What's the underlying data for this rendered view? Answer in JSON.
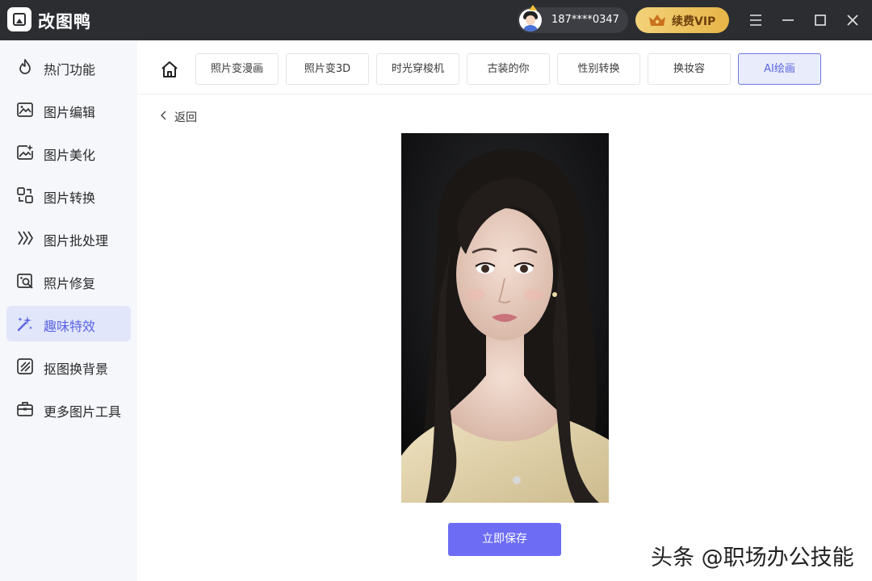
{
  "app": {
    "title": "改图鸭"
  },
  "user": {
    "phone": "187****0347"
  },
  "vip": {
    "label": "续费VIP"
  },
  "window_controls": [
    "menu-icon",
    "minimize-icon",
    "maximize-icon",
    "close-icon"
  ],
  "sidebar": {
    "items": [
      {
        "label": "热门功能",
        "icon": "fire-icon",
        "active": false
      },
      {
        "label": "图片编辑",
        "icon": "image-edit-icon",
        "active": false
      },
      {
        "label": "图片美化",
        "icon": "image-beautify-icon",
        "active": false
      },
      {
        "label": "图片转换",
        "icon": "convert-icon",
        "active": false
      },
      {
        "label": "图片批处理",
        "icon": "batch-icon",
        "active": false
      },
      {
        "label": "照片修复",
        "icon": "photo-repair-icon",
        "active": false
      },
      {
        "label": "趣味特效",
        "icon": "magic-wand-icon",
        "active": true
      },
      {
        "label": "抠图换背景",
        "icon": "cutout-icon",
        "active": false
      },
      {
        "label": "更多图片工具",
        "icon": "toolbox-icon",
        "active": false
      }
    ]
  },
  "tabs": [
    {
      "label": "照片变漫画",
      "active": false
    },
    {
      "label": "照片变3D",
      "active": false
    },
    {
      "label": "时光穿梭机",
      "active": false
    },
    {
      "label": "古装的你",
      "active": false
    },
    {
      "label": "性别转换",
      "active": false
    },
    {
      "label": "换妆容",
      "active": false
    },
    {
      "label": "AI绘画",
      "active": true
    }
  ],
  "content": {
    "back_label": "返回",
    "save_label": "立即保存"
  },
  "watermark": "头条 @职场办公技能",
  "colors": {
    "titlebar": "#2b2d31",
    "accent": "#6d6cf4",
    "sidebar_bg": "#f5f7fb",
    "active_item_bg": "#e1e6fb",
    "vip_gold": "#e7b447"
  }
}
